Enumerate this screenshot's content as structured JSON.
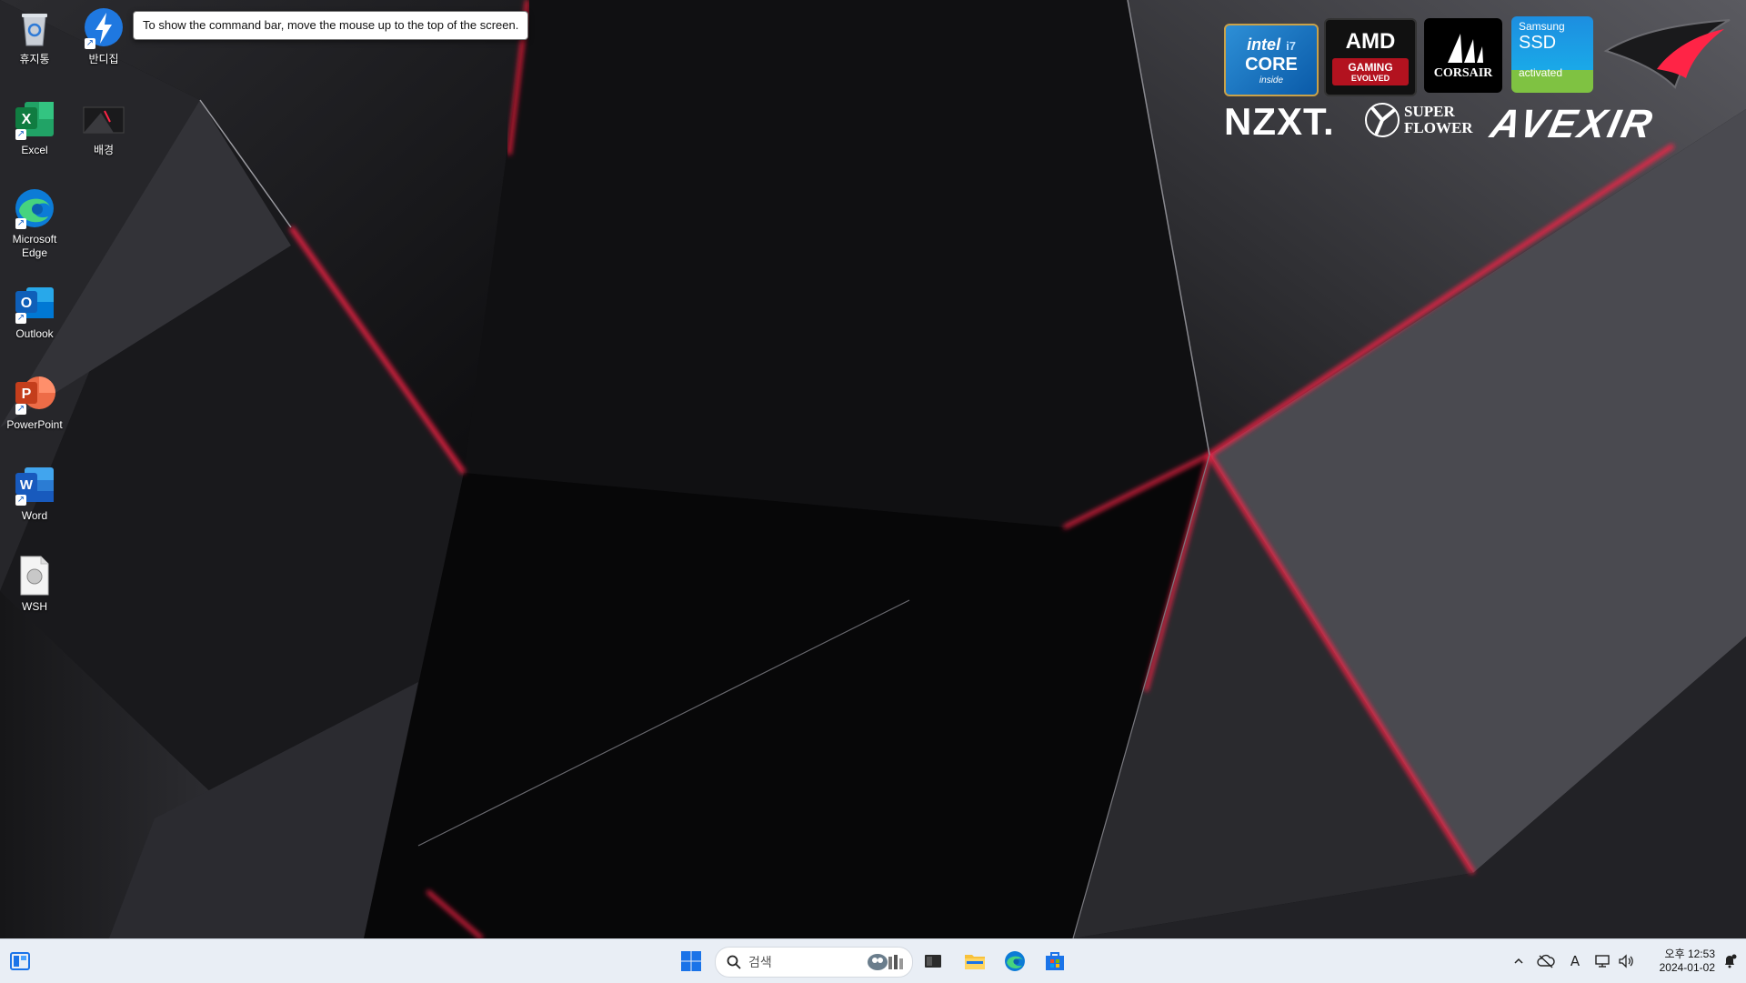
{
  "tooltip": {
    "text": "To show the command bar, move the mouse up to the top of the screen."
  },
  "desktop": {
    "icons": [
      {
        "label": "휴지통",
        "icon": "recycle-bin-icon"
      },
      {
        "label": "반디집",
        "icon": "bandizip-icon"
      },
      {
        "label": "Excel",
        "icon": "excel-icon"
      },
      {
        "label": "배경",
        "icon": "image-icon"
      },
      {
        "label": "Microsoft Edge",
        "icon": "edge-icon"
      },
      {
        "label": "Outlook",
        "icon": "outlook-icon"
      },
      {
        "label": "PowerPoint",
        "icon": "powerpoint-icon"
      },
      {
        "label": "Word",
        "icon": "word-icon"
      },
      {
        "label": "WSH",
        "icon": "script-file-icon"
      }
    ]
  },
  "logos": {
    "intel": {
      "brand": "intel",
      "line": "CORE",
      "model": "i7",
      "sub": "inside"
    },
    "amd": {
      "brand": "AMD",
      "sub1": "GAMING",
      "sub2": "EVOLVED"
    },
    "corsair": {
      "brand": "CORSAIR"
    },
    "samsung": {
      "brand": "Samsung",
      "line": "SSD",
      "sub": "activated"
    },
    "nzxt": {
      "brand": "NZXT."
    },
    "superflower": {
      "line1": "SUPER",
      "line2": "FLOWER"
    },
    "avexir": {
      "brand": "AVEXIR"
    }
  },
  "taskbar": {
    "search_placeholder": "검색",
    "clock_time": "오후 12:53",
    "clock_date": "2024-01-02",
    "ime_indicator": "A"
  },
  "colors": {
    "accent_red": "#ff1e3c",
    "taskbar_bg": "#e9eef5",
    "start_blue": "#1a73e8"
  }
}
